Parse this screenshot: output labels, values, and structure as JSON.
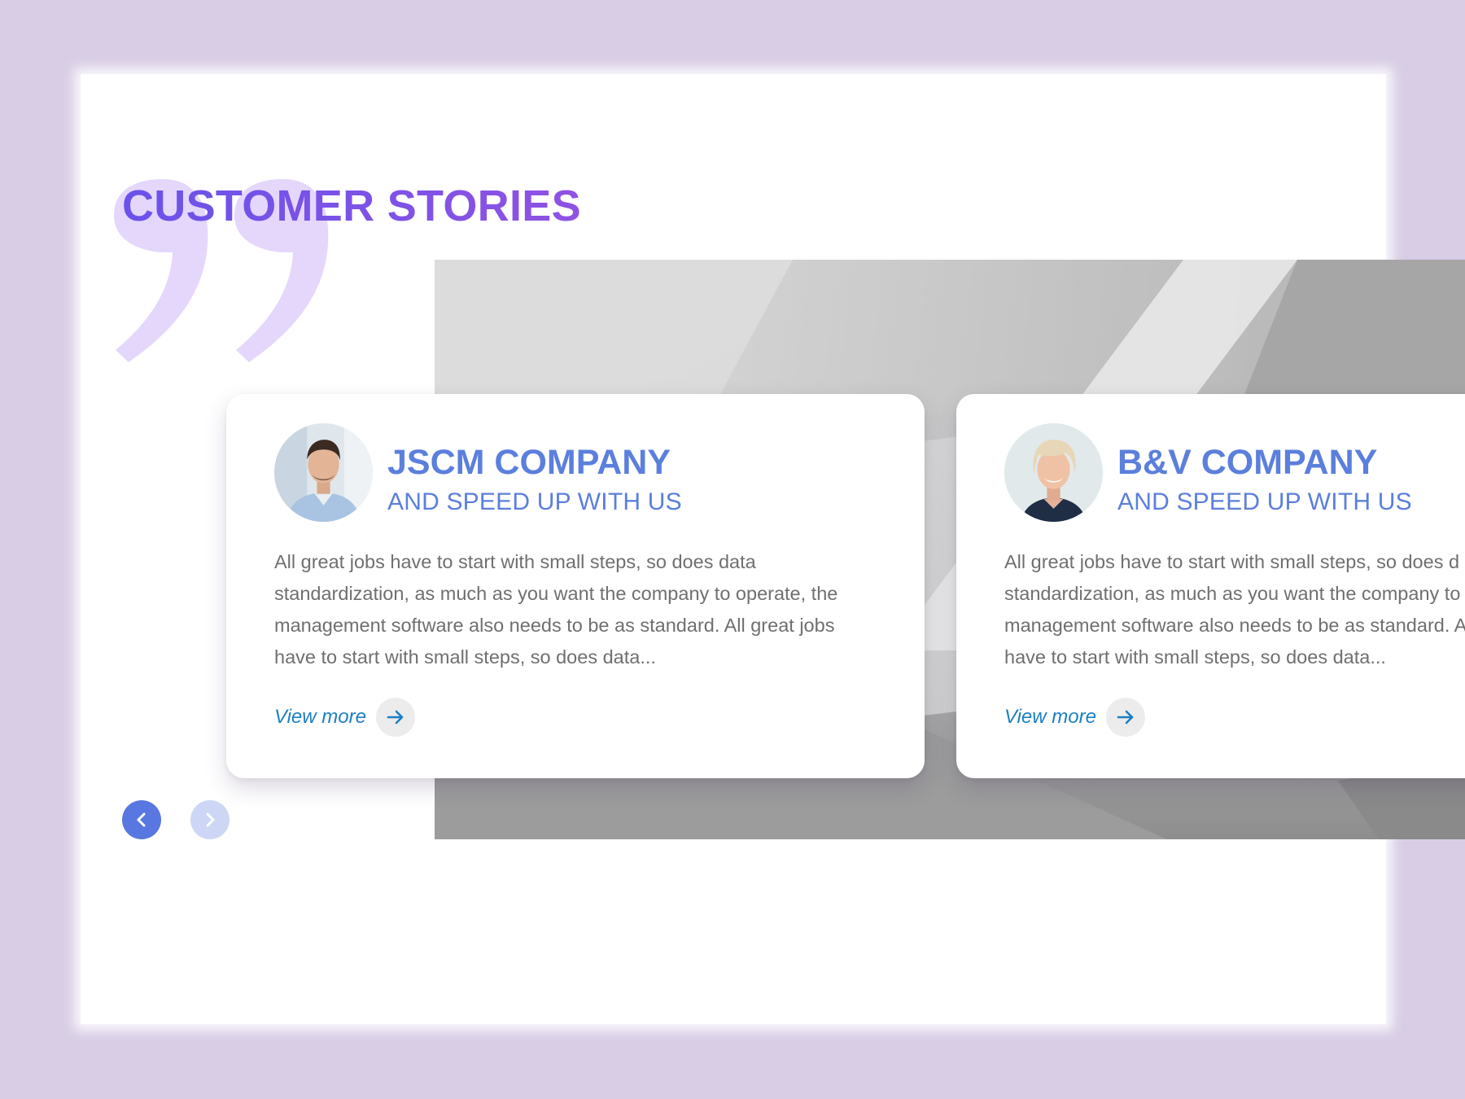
{
  "section": {
    "title": "CUSTOMER STORIES"
  },
  "stories": [
    {
      "company": "JSCM COMPANY",
      "tagline": "AND SPEED UP WITH US",
      "description_lines": [
        "All great jobs have to start with small steps, so does data",
        "standardization, as much as you want the company to operate, the",
        "management software also needs to be as standard. All great jobs",
        "have to start with small steps, so does data..."
      ],
      "view_more_label": "View more"
    },
    {
      "company": "B&V COMPANY",
      "tagline": "AND SPEED UP WITH US",
      "description_lines": [
        "All great jobs have to start with small steps, so does d",
        "standardization, as much as you want the company to",
        "management software also needs to be as standard. All",
        "have to start with small steps, so does data..."
      ],
      "view_more_label": "View more"
    }
  ],
  "carousel": {
    "prev_icon": "chevron-left-icon",
    "next_icon": "chevron-right-icon",
    "active_prev": true,
    "active_next": false
  },
  "colors": {
    "page_background": "#d8cde5",
    "title_gradient_start": "#6a52ea",
    "title_gradient_end": "#8f52e3",
    "quote_mark": "#e4d7fb",
    "company_blue": "#5b7fdc",
    "body_text": "#6f6f6f",
    "link_blue": "#1c7fc4",
    "nav_active": "#5877e0",
    "nav_inactive": "#cdd6f4"
  }
}
